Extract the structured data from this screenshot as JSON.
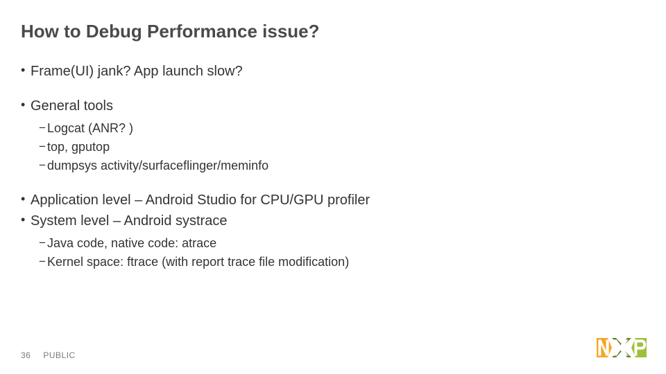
{
  "title": "How to Debug Performance issue?",
  "bullets": {
    "b0": "Frame(UI) jank? App launch slow?",
    "b1": "General tools",
    "b1_sub": {
      "s0": "Logcat (ANR? )",
      "s1": "top, gputop",
      "s2": "dumpsys activity/surfaceflinger/meminfo"
    },
    "b2": "Application level – Android Studio for CPU/GPU profiler",
    "b3": "System level – Android systrace",
    "b3_sub": {
      "s0": "Java code, native code: atrace",
      "s1": "Kernel space: ftrace (with report trace file modification)"
    }
  },
  "footer": {
    "page": "36",
    "label": "PUBLIC"
  },
  "brand": {
    "name": "NXP"
  }
}
